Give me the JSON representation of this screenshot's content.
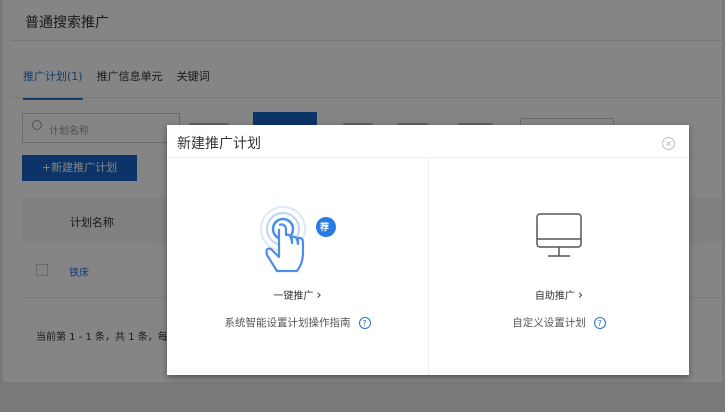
{
  "page": {
    "title": "普通搜索推广",
    "tabs": [
      {
        "label": "推广计划(1)"
      },
      {
        "label": "推广信息单元"
      },
      {
        "label": "关键词"
      }
    ],
    "search_placeholder": "计划名称",
    "new_plan_button": "+新建推广计划",
    "table": {
      "header": "计划名称",
      "rows": [
        {
          "name": "铁床"
        }
      ]
    },
    "pager": "当前第 1 - 1 条，共 1 条，每"
  },
  "modal": {
    "title": "新建推广计划",
    "close": "×",
    "options": [
      {
        "label": "一键推广",
        "description": "系统智能设置计划操作指南",
        "badge": "荐",
        "icon": "tap-hand-icon"
      },
      {
        "label": "自助推广",
        "description": "自定义设置计划",
        "icon": "monitor-icon"
      }
    ],
    "help": "?",
    "chevron": "›"
  },
  "colors": {
    "accent": "#1a64c8",
    "link": "#2a6fd0"
  }
}
